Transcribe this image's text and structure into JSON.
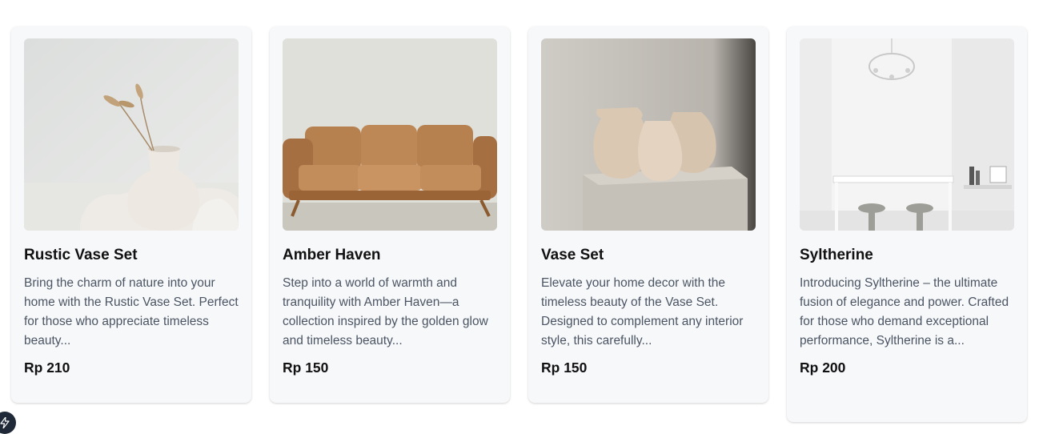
{
  "products": [
    {
      "title": "Rustic Vase Set",
      "description": "Bring the charm of nature into your home with the Rustic Vase Set. Perfect for those who appreciate timeless beauty...",
      "price": "Rp 210",
      "image_icon": "vase-photo"
    },
    {
      "title": "Amber Haven",
      "description": "Step into a world of warmth and tranquility with Amber Haven—a collection inspired by the golden glow and timeless beauty...",
      "price": "Rp 150",
      "image_icon": "sofa-photo"
    },
    {
      "title": "Vase Set",
      "description": "Elevate your home decor with the timeless beauty of the Vase Set. Designed to complement any interior style, this carefully...",
      "price": "Rp 150",
      "image_icon": "pottery-photo"
    },
    {
      "title": "Syltherine",
      "description": "Introducing Syltherine – the ultimate fusion of elegance and power. Crafted for those who demand exceptional performance, Syltherine is a...",
      "price": "Rp 200",
      "image_icon": "dining-room-photo"
    }
  ],
  "corner_badge_icon": "bolt-icon"
}
